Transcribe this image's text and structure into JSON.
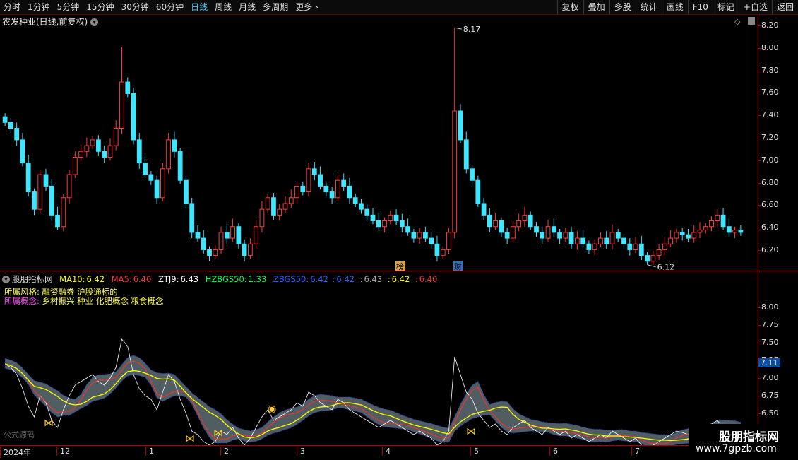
{
  "toolbar": {
    "timeframes": [
      "分时",
      "1分钟",
      "5分钟",
      "15分钟",
      "30分钟",
      "60分钟",
      "日线",
      "周线",
      "月线",
      "多周期",
      "更多"
    ],
    "active": "日线",
    "tools": [
      "复权",
      "叠加",
      "多股",
      "统计",
      "画线",
      "F10",
      "标记",
      "+自选",
      "返回"
    ]
  },
  "main": {
    "title": "农发种业(日线,前复权)",
    "high_label": "8.17",
    "low_label": "6.12",
    "badge_rank": "榜",
    "badge_fin": "财",
    "y_ticks": [
      "8.20",
      "8.00",
      "7.80",
      "7.60",
      "7.40",
      "7.20",
      "7.00",
      "6.80",
      "6.60",
      "6.40",
      "6.20"
    ]
  },
  "indicator": {
    "name": "股朋指标网",
    "ma10_label": "MA10:",
    "ma10_value": "6.42",
    "ma5_label": "MA5:",
    "ma5_value": "6.40",
    "ztj9_label": "ZTJ9:",
    "ztj9_value": "6.43",
    "hzbgs50_label": "HZBGS50:",
    "hzbgs50_value": "1.33",
    "zbgs50_label": "ZBGS50:",
    "zbgs50_value": "6.42",
    "extra1": "6.42",
    "extra2": "6.43",
    "extra3": "6.42",
    "extra4": "6.40",
    "style_label": "所属风格:",
    "style_value": "融资融券 沪股通标的",
    "concept_label": "所属概念:",
    "concept_value": "乡村振兴 种业 化肥概念 粮食概念",
    "formula": "公式源码",
    "current_value": "7.11",
    "y_ticks": [
      "8.00",
      "7.75",
      "7.50",
      "7.25",
      "7.00",
      "6.75",
      "6.50"
    ]
  },
  "dates": {
    "year": "2024年",
    "months": [
      "12",
      "1",
      "2",
      "3",
      "4",
      "5",
      "6",
      "7"
    ]
  },
  "watermark": {
    "name": "股朋指标网",
    "url": "www.7gpzb.com"
  },
  "colors": {
    "up": "#ff3b3b",
    "down": "#3ee6ff",
    "ma10": "#ffff00",
    "ma5": "#ff3030",
    "ztj9": "#ffffff",
    "hz": "#00ff40",
    "zb": "#3060ff",
    "band": "#5e6e75",
    "band_hi": "#7a3868"
  },
  "chart_data": {
    "type": "candlestick",
    "price_range": [
      6.12,
      8.17
    ],
    "ylim": [
      6.1,
      8.25
    ],
    "close": [
      7.35,
      7.3,
      7.2,
      7.0,
      6.75,
      6.6,
      6.9,
      6.8,
      6.55,
      6.45,
      6.7,
      6.9,
      7.05,
      7.1,
      7.15,
      7.2,
      7.1,
      7.05,
      7.15,
      7.3,
      7.7,
      7.6,
      7.2,
      7.0,
      6.9,
      6.85,
      6.7,
      6.95,
      7.2,
      7.1,
      6.85,
      6.65,
      6.4,
      6.35,
      6.25,
      6.2,
      6.25,
      6.4,
      6.35,
      6.45,
      6.3,
      6.2,
      6.3,
      6.45,
      6.6,
      6.7,
      6.55,
      6.6,
      6.65,
      6.7,
      6.8,
      6.75,
      6.95,
      6.9,
      6.8,
      6.75,
      6.7,
      6.85,
      6.8,
      6.7,
      6.65,
      6.6,
      6.55,
      6.5,
      6.45,
      6.5,
      6.55,
      6.5,
      6.45,
      6.4,
      6.35,
      6.4,
      6.35,
      6.3,
      6.2,
      6.25,
      6.4,
      7.45,
      7.2,
      6.95,
      6.85,
      6.65,
      6.55,
      6.45,
      6.5,
      6.4,
      6.35,
      6.45,
      6.5,
      6.55,
      6.45,
      6.4,
      6.35,
      6.45,
      6.4,
      6.35,
      6.4,
      6.3,
      6.35,
      6.3,
      6.25,
      6.3,
      6.35,
      6.3,
      6.4,
      6.35,
      6.3,
      6.25,
      6.3,
      6.2,
      6.15,
      6.2,
      6.25,
      6.3,
      6.35,
      6.4,
      6.38,
      6.35,
      6.4,
      6.42,
      6.45,
      6.5,
      6.55,
      6.45,
      6.4,
      6.42,
      6.4
    ],
    "indicator_series": [
      {
        "name": "MA10",
        "value": 6.42
      },
      {
        "name": "MA5",
        "value": 6.4
      },
      {
        "name": "ZTJ9",
        "value": 6.43
      },
      {
        "name": "HZBGS50",
        "value": 1.33
      },
      {
        "name": "ZBGS50",
        "value": 6.42
      }
    ],
    "indicator_ylim": [
      6.35,
      8.1
    ]
  }
}
